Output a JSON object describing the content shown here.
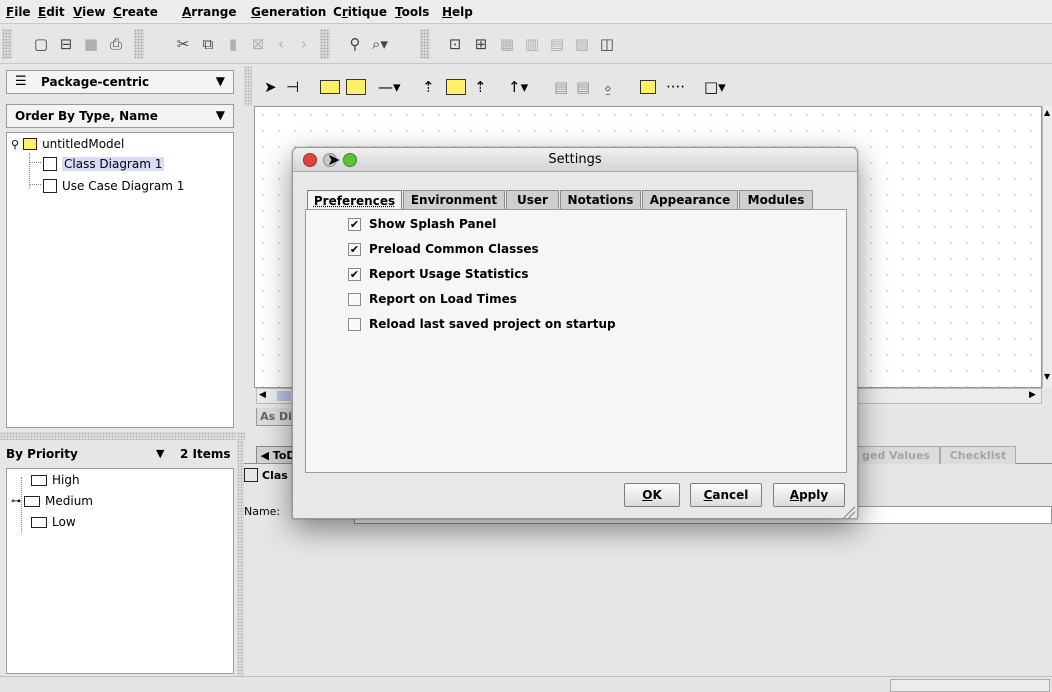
{
  "menu": {
    "file": {
      "u": "F",
      "rest": "ile"
    },
    "edit": {
      "u": "E",
      "rest": "dit"
    },
    "view": {
      "u": "V",
      "rest": "iew"
    },
    "create": {
      "u": "C",
      "rest": "reate"
    },
    "arrange": {
      "u": "A",
      "rest": "rrange"
    },
    "generation": {
      "u": "G",
      "rest": "eneration"
    },
    "critique": {
      "pre": "C",
      "u": "r",
      "rest": "itique"
    },
    "tools": {
      "u": "T",
      "rest": "ools"
    },
    "help": {
      "u": "H",
      "rest": "elp"
    }
  },
  "left_top": {
    "perspective": "Package-centric",
    "order": "Order By Type, Name",
    "tree": {
      "root": "untitledModel",
      "children": [
        "Class Diagram 1",
        "Use Case Diagram 1"
      ]
    }
  },
  "left_bottom": {
    "priority_label": "By Priority",
    "item_count": "2 Items",
    "items": [
      "High",
      "Medium",
      "Low"
    ]
  },
  "canvas": {
    "tab_label": "As Di"
  },
  "detail": {
    "todo_tab": "◀ ToD",
    "class_label": "Clas",
    "name_label": "Name:",
    "tagged_values_tab": "ged Values",
    "checklist_tab": "Checklist"
  },
  "dialog": {
    "title": "Settings",
    "tabs": [
      "Preferences",
      "Environment",
      "User",
      "Notations",
      "Appearance",
      "Modules"
    ],
    "options": [
      {
        "label": "Show Splash Panel",
        "checked": true
      },
      {
        "label": "Preload Common Classes",
        "checked": true
      },
      {
        "label": "Report Usage Statistics",
        "checked": true
      },
      {
        "label": "Report on Load Times",
        "checked": false
      },
      {
        "label": "Reload last saved project on startup",
        "checked": false
      }
    ],
    "buttons": {
      "ok": {
        "u": "O",
        "rest": "K"
      },
      "cancel": {
        "u": "C",
        "rest": "ancel"
      },
      "apply": {
        "u": "A",
        "rest": "pply"
      }
    },
    "check_mark": "✔"
  },
  "colors": {
    "selection": "#d6dcf5",
    "traffic_red": "#e0443e",
    "traffic_yellow": "#c9c9c9",
    "traffic_green": "#5bc33a",
    "folder_yellow": "#fff066"
  }
}
